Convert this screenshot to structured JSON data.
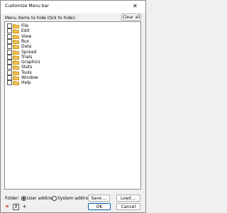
{
  "window": {
    "title": "Customize Menu bar",
    "close": "✕"
  },
  "hint": "Menu items to hide (tick to hide):",
  "buttons": {
    "clear_all": "Clear all",
    "save": "Save....",
    "load": "Load....",
    "ok": "OK",
    "cancel": "Cancel"
  },
  "menu_items": [
    {
      "label": "File",
      "checked": false
    },
    {
      "label": "Edit",
      "checked": false
    },
    {
      "label": "View",
      "checked": false
    },
    {
      "label": "Run",
      "checked": false
    },
    {
      "label": "Data",
      "checked": false
    },
    {
      "label": "Spread",
      "checked": false
    },
    {
      "label": "Trials",
      "checked": false
    },
    {
      "label": "Graphics",
      "checked": false
    },
    {
      "label": "Stats",
      "checked": false
    },
    {
      "label": "Tools",
      "checked": false
    },
    {
      "label": "Window",
      "checked": false
    },
    {
      "label": "Help",
      "checked": false
    }
  ],
  "folder": {
    "label": "Folder:",
    "options": [
      {
        "label": "User addins",
        "selected": true
      },
      {
        "label": "System addins",
        "selected": false
      }
    ]
  },
  "toolbar_icons": [
    {
      "name": "delete-icon",
      "glyph": "✕",
      "color": "#c00000"
    },
    {
      "name": "help-icon",
      "glyph": "?",
      "color": "#000000"
    },
    {
      "name": "add-icon",
      "glyph": "+",
      "color": "#000000"
    }
  ]
}
